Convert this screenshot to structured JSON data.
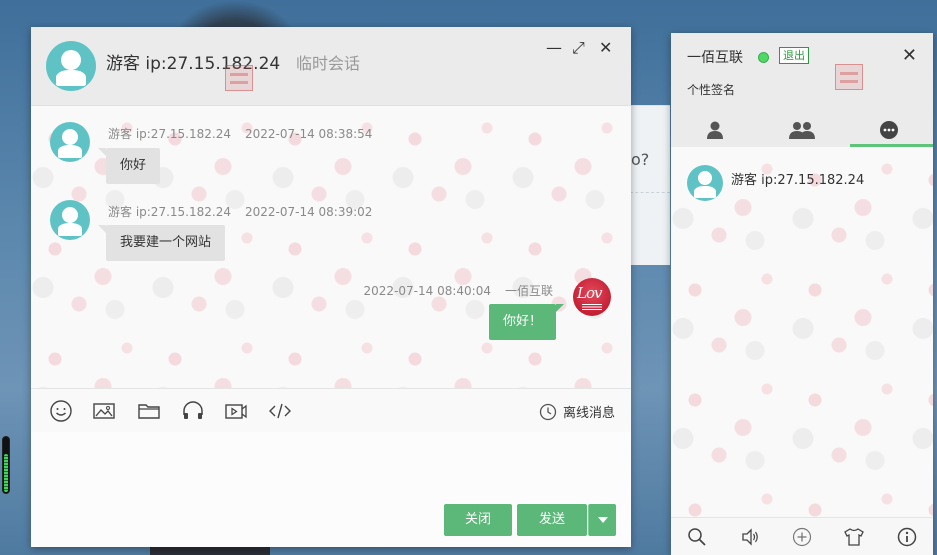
{
  "chat": {
    "title": "游客 ip:27.15.182.24",
    "subtitle": "临时会话",
    "controls": {
      "minimize": "—",
      "maximize": "⤢",
      "close": "✕"
    },
    "messages": [
      {
        "sender": "游客 ip:27.15.182.24",
        "time": "2022-07-14 08:38:54",
        "text": "你好",
        "direction": "in"
      },
      {
        "sender": "游客 ip:27.15.182.24",
        "time": "2022-07-14 08:39:02",
        "text": "我要建一个网站",
        "direction": "in"
      },
      {
        "sender": "一佰互联",
        "time": "2022-07-14 08:40:04",
        "text": "你好！",
        "direction": "out"
      }
    ],
    "toolbar": {
      "icons": [
        "emoji-icon",
        "image-icon",
        "folder-icon",
        "headphones-icon",
        "video-icon",
        "code-icon"
      ],
      "offline_label": "离线消息"
    },
    "input": {
      "value": "",
      "placeholder": ""
    },
    "buttons": {
      "close_label": "关闭",
      "send_label": "发送"
    }
  },
  "background": {
    "page_text": "o?"
  },
  "panel": {
    "name": "一佰互联",
    "status": "online",
    "logout_label": "退出",
    "close_label": "✕",
    "signature": "个性签名",
    "tabs": [
      "friends-tab",
      "groups-tab",
      "chats-tab"
    ],
    "active_tab": "chats-tab",
    "contacts": [
      {
        "name": "游客 ip:27.15.182.24"
      }
    ],
    "footer_icons": [
      "search-icon",
      "volume-icon",
      "add-icon",
      "skin-icon",
      "info-icon"
    ]
  },
  "colors": {
    "accent_green": "#5cb878",
    "avatar_teal": "#5fc3c6",
    "header_gray": "#ebebeb",
    "online_green": "#4cd964"
  }
}
